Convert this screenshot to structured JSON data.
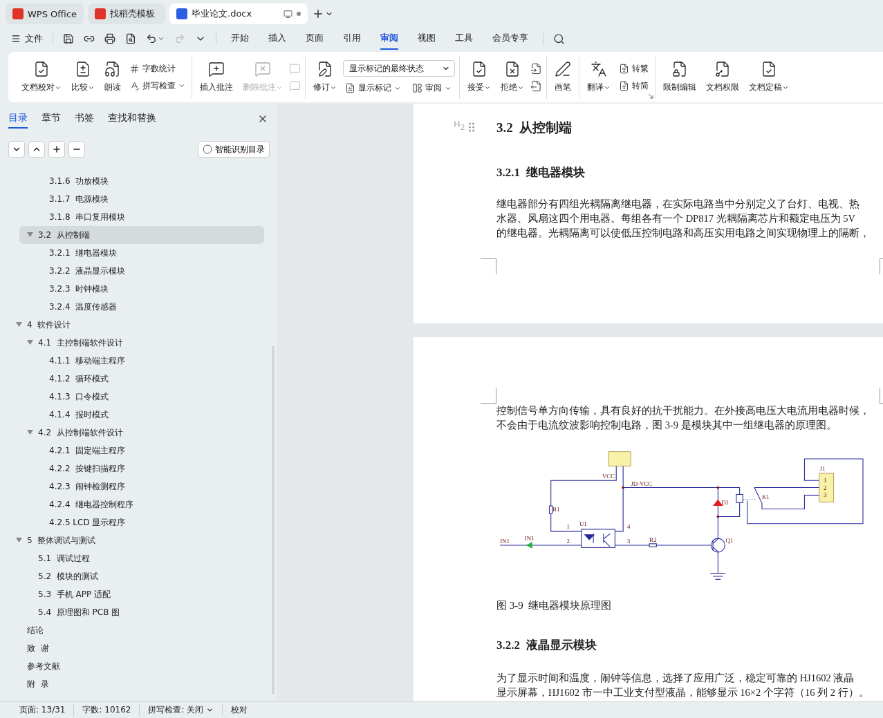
{
  "app_tabs": [
    {
      "label": "WPS Office",
      "selected": false
    },
    {
      "label": "找稻壳模板",
      "selected": false
    },
    {
      "label": "毕业论文.docx",
      "selected": true
    }
  ],
  "menu": {
    "file": "文件",
    "quick": [
      {
        "disabled": false,
        "dropdown": false
      },
      {
        "disabled": false,
        "dropdown": false
      },
      {
        "disabled": false,
        "dropdown": false
      },
      {
        "disabled": false,
        "dropdown": false
      },
      {
        "disabled": false,
        "dropdown": true
      },
      {
        "disabled": true,
        "dropdown": false
      },
      {
        "disabled": false,
        "dropdown": false
      }
    ],
    "tabs": [
      {
        "label": "开始",
        "selected": false
      },
      {
        "label": "插入",
        "selected": false
      },
      {
        "label": "页面",
        "selected": false
      },
      {
        "label": "引用",
        "selected": false
      },
      {
        "label": "审阅",
        "selected": true
      },
      {
        "label": "视图",
        "selected": false
      },
      {
        "label": "工具",
        "selected": false
      },
      {
        "label": "会员专享",
        "selected": false
      }
    ]
  },
  "ribbon": {
    "groups": [
      {
        "items": [
          {
            "kind": "big",
            "label": "文档校对",
            "dropdown": true,
            "disabled": false
          },
          {
            "kind": "big",
            "label": "比较",
            "dropdown": true,
            "disabled": false
          },
          {
            "kind": "big",
            "label": "朗读",
            "dropdown": false,
            "disabled": false
          },
          {
            "kind": "stack",
            "rows": [
              {
                "label": "字数统计",
                "dropdown": false
              },
              {
                "label": "拼写检查",
                "dropdown": true
              }
            ]
          }
        ]
      },
      {
        "items": [
          {
            "kind": "big",
            "label": "插入批注",
            "dropdown": false,
            "disabled": false
          },
          {
            "kind": "big",
            "label": "删除批注",
            "dropdown": true,
            "disabled": true
          },
          {
            "kind": "icon_stack",
            "buttons": [
              {
                "disabled": true
              },
              {
                "disabled": true
              }
            ]
          }
        ]
      },
      {
        "items": [
          {
            "kind": "big",
            "label": "修订",
            "dropdown": true,
            "disabled": false
          },
          {
            "kind": "review",
            "select": {
              "value": "显示标记的最终状态"
            },
            "rows": [
              {
                "label": "显示标记",
                "dropdown": true
              },
              {
                "label": "审阅",
                "dropdown": true
              }
            ]
          }
        ]
      },
      {
        "items": [
          {
            "kind": "big",
            "label": "接受",
            "dropdown": true,
            "disabled": false
          },
          {
            "kind": "big",
            "label": "拒绝",
            "dropdown": true,
            "disabled": false
          },
          {
            "kind": "icon_stack",
            "buttons": [
              {
                "disabled": false
              },
              {
                "disabled": false
              }
            ]
          }
        ]
      },
      {
        "items": [
          {
            "kind": "big",
            "label": "画笔",
            "dropdown": false,
            "disabled": false
          }
        ]
      },
      {
        "launcher": true,
        "items": [
          {
            "kind": "big",
            "label": "翻译",
            "dropdown": true,
            "disabled": false
          },
          {
            "kind": "stack",
            "rows": [
              {
                "label": "转繁",
                "dropdown": false
              },
              {
                "label": "转简",
                "dropdown": false
              }
            ]
          }
        ]
      },
      {
        "items": [
          {
            "kind": "big",
            "label": "限制编辑",
            "dropdown": false,
            "disabled": false
          },
          {
            "kind": "big",
            "label": "文档权限",
            "dropdown": false,
            "disabled": false
          },
          {
            "kind": "big",
            "label": "文档定稿",
            "dropdown": true,
            "disabled": false
          }
        ]
      }
    ]
  },
  "sidebar": {
    "tabs": [
      {
        "label": "目录",
        "selected": true
      },
      {
        "label": "章节",
        "selected": false
      },
      {
        "label": "书签",
        "selected": false
      },
      {
        "label": "查找和替换",
        "selected": false
      }
    ],
    "smart_button": "智能识别目录",
    "toc": [
      {
        "children": [
          {
            "children": [
              {
                "label": "3.1.6  功放模块",
                "selected": false
              },
              {
                "label": "3.1.7  电源模块",
                "selected": false
              },
              {
                "label": "3.1.8  串口复用模块",
                "selected": false
              }
            ]
          },
          {
            "label": "3.2  从控制端",
            "expanded": true,
            "selected": true,
            "children": [
              {
                "label": "3.2.1  继电器模块",
                "selected": false
              },
              {
                "label": "3.2.2  液晶显示模块",
                "selected": false
              },
              {
                "label": "3.2.3  时钟模块",
                "selected": false
              },
              {
                "label": "3.2.4  温度传感器",
                "selected": false
              }
            ]
          }
        ]
      },
      {
        "label": "4  软件设计",
        "expanded": true,
        "selected": false,
        "children": [
          {
            "label": "4.1  主控制端软件设计",
            "expanded": true,
            "selected": false,
            "children": [
              {
                "label": "4.1.1  移动端主程序",
                "selected": false
              },
              {
                "label": "4.1.2  循环模式",
                "selected": false
              },
              {
                "label": "4.1.3  口令模式",
                "selected": false
              },
              {
                "label": "4.1.4  报时模式",
                "selected": false
              }
            ]
          },
          {
            "label": "4.2  从控制端软件设计",
            "expanded": true,
            "selected": false,
            "children": [
              {
                "label": "4.2.1  固定端主程序",
                "selected": false
              },
              {
                "label": "4.2.2  按键扫描程序",
                "selected": false
              },
              {
                "label": "4.2.3  闹钟检测程序",
                "selected": false
              },
              {
                "label": "4.2.4  继电器控制程序",
                "selected": false
              },
              {
                "label": "4.2.5 LCD 显示程序",
                "selected": false
              }
            ]
          }
        ]
      },
      {
        "label": "5  整体调试与测试",
        "expanded": true,
        "selected": false,
        "children": [
          {
            "label": "5.1  调试过程",
            "selected": false
          },
          {
            "label": "5.2  模块的测试",
            "selected": false
          },
          {
            "label": "5.3  手机 APP 适配",
            "selected": false
          },
          {
            "label": "5.4  原理图和 PCB 图",
            "selected": false
          }
        ]
      },
      {
        "label": "结论",
        "selected": false
      },
      {
        "label": "致  谢",
        "selected": false
      },
      {
        "label": "参考文献",
        "selected": false
      },
      {
        "label": "附  录",
        "selected": false
      }
    ]
  },
  "document": {
    "heading_marker": "H$_{2}$",
    "heading": "3.2  从控制端",
    "subheading_1": "3.2.1  继电器模块",
    "paragraph_1": [
      "继电器部分有四组光耦隔离继电器，在实际电路当中分别定义了台灯、电视、热",
      "水器、风扇这四个用电器。每组各有一个 DP817 光耦隔离芯片和额定电压为 5V",
      "的继电器。光耦隔离可以使低压控制电路和高压实用电路之间实现物理上的隔断，"
    ],
    "paragraph_2": [
      "控制信号单方向传输，具有良好的抗干扰能力。在外接高电压大电流用电器时候，",
      "不会由于电流纹波影响控制电路，图 3-9 是模块其中一组继电器的原理图。"
    ],
    "schematic_labels": [
      "VCC",
      "JD-VCC",
      "R1",
      "U1",
      "1",
      "4",
      "IN1",
      "IN1",
      "2",
      "3",
      "R2",
      "Q1",
      "D1",
      "K1",
      "J1",
      "1",
      "2",
      "3"
    ],
    "caption": "图 3-9  继电器模块原理图",
    "subheading_2": "3.2.2  液晶显示模块",
    "paragraph_3": [
      "为了显示时间和温度，闹钟等信息，选择了应用广泛，稳定可靠的 HJ1602 液晶",
      "显示屏幕，HJ1602 市一中工业支付型液晶，能够显示 16×2 个字符（16 列 2 行）。"
    ]
  },
  "status_bar": [
    {
      "kind": "text",
      "label": "页面: 13/31"
    },
    {
      "kind": "text",
      "label": "字数: 10162"
    },
    {
      "kind": "dropdown",
      "label": "拼写检查: 关闭"
    },
    {
      "kind": "text",
      "label": "校对"
    }
  ]
}
